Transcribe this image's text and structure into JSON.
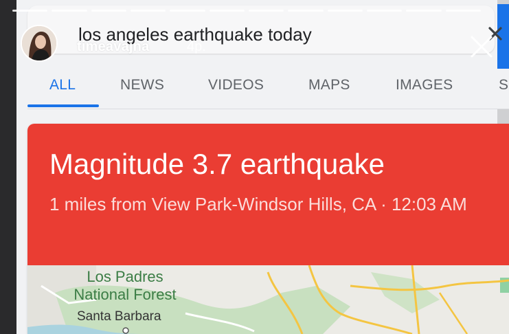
{
  "search": {
    "query": "los angeles earthquake today"
  },
  "story": {
    "username": "timeavajna",
    "time": "4p."
  },
  "tabs": [
    {
      "label": "ALL",
      "active": true
    },
    {
      "label": "NEWS",
      "active": false
    },
    {
      "label": "VIDEOS",
      "active": false
    },
    {
      "label": "MAPS",
      "active": false
    },
    {
      "label": "IMAGES",
      "active": false
    },
    {
      "label": "S",
      "active": false
    }
  ],
  "card": {
    "title": "Magnitude 3.7 earthquake",
    "subtitle": "1 miles from View Park-Windsor Hills, CA · 12:03 AM",
    "accent_color": "#ea3d33"
  },
  "map": {
    "forest_label": "Los Padres National Forest",
    "city_label": "Santa Barbara"
  },
  "colors": {
    "tab_active": "#1a73e8",
    "tab_inactive": "#5f6368"
  },
  "icons": [
    "clear-search-icon",
    "story-close-icon"
  ]
}
